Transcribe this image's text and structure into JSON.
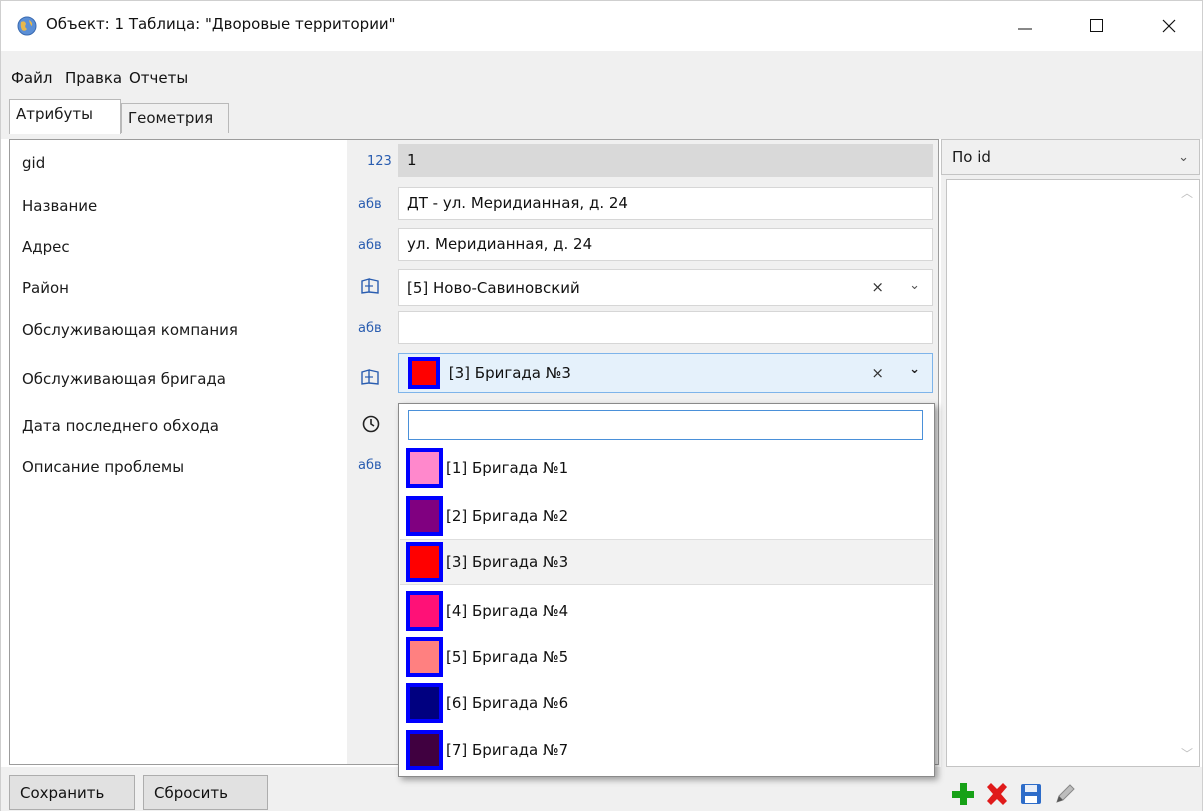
{
  "window": {
    "title": "Объект: 1 Таблица: \"Дворовые территории\""
  },
  "menu": {
    "items": [
      "Файл",
      "Правка",
      "Отчеты"
    ]
  },
  "tabs": [
    {
      "label": "Атрибуты",
      "active": true
    },
    {
      "label": "Геометрия",
      "active": false
    }
  ],
  "fields": [
    {
      "label": "gid",
      "type_icon": "123",
      "value": "1",
      "readonly": true
    },
    {
      "label": "Название",
      "type_icon": "абв",
      "value": "ДТ - ул. Меридианная, д. 24"
    },
    {
      "label": "Адрес",
      "type_icon": "абв",
      "value": "ул. Меридианная, д. 24"
    },
    {
      "label": "Район",
      "type_icon": "book-icon",
      "value": "[5]  Ново-Савиновский",
      "clear": "×"
    },
    {
      "label": "Обслуживающая компания",
      "type_icon": "абв",
      "value": ""
    },
    {
      "label": "Обслуживающая бригада",
      "type_icon": "book-icon",
      "value": "[3] Бригада №3",
      "swatch_color": "#ff0000",
      "clear": "×"
    },
    {
      "label": "Дата последнего обхода",
      "type_icon": "clock-icon",
      "value": ""
    },
    {
      "label": "Описание проблемы",
      "type_icon": "абв",
      "value": ""
    }
  ],
  "dropdown": {
    "search_value": "",
    "items": [
      {
        "label": "[1] Бригада №1",
        "color": "#ff88cc"
      },
      {
        "label": "[2] Бригада №2",
        "color": "#800080"
      },
      {
        "label": "[3] Бригада №3",
        "color": "#ff0000",
        "selected": true
      },
      {
        "label": "[4] Бригада №4",
        "color": "#ff1177"
      },
      {
        "label": "[5] Бригада №5",
        "color": "#ff8080"
      },
      {
        "label": "[6] Бригада №6",
        "color": "#000080"
      },
      {
        "label": "[7] Бригада №7",
        "color": "#400040"
      }
    ]
  },
  "right_panel": {
    "sort_label": "По id"
  },
  "buttons": {
    "save": "Сохранить",
    "reset": "Сбросить"
  },
  "colors": {
    "swatch_border": "#0000ff",
    "accent": "#2a5db0"
  }
}
